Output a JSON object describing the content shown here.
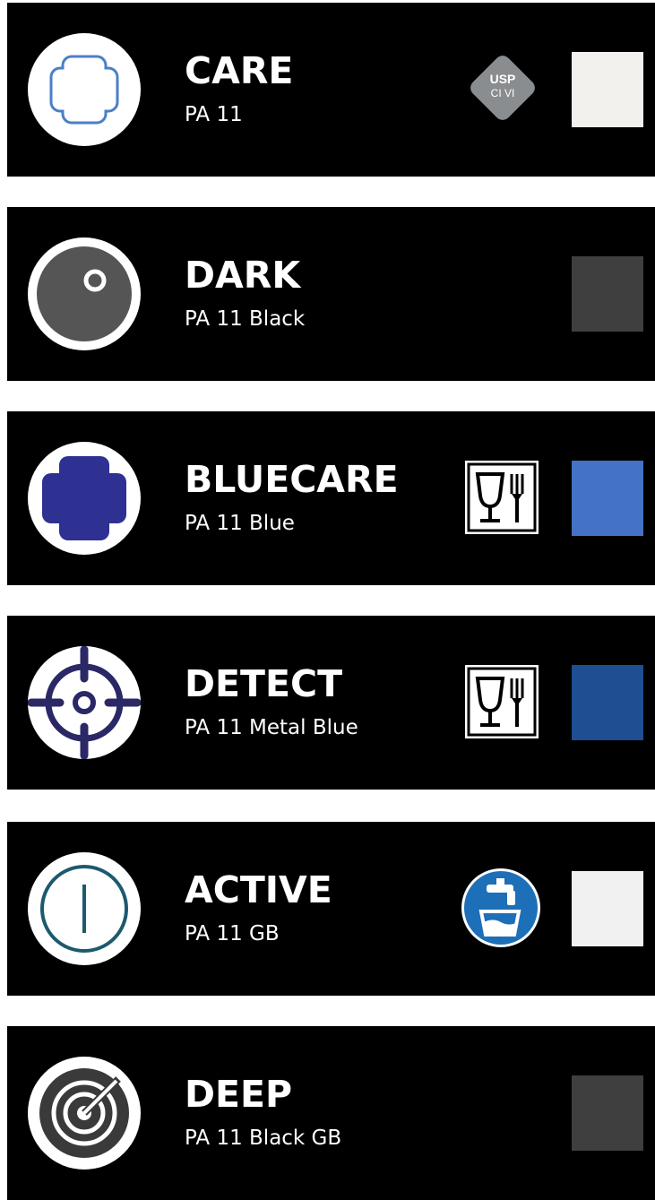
{
  "products": [
    {
      "name": "CARE",
      "grade": "PA 11",
      "icon": "cross-outline-icon",
      "badge": {
        "type": "usp-class-vi",
        "line1": "USP",
        "line2": "CI VI"
      },
      "swatch_color": "#f2f1ed"
    },
    {
      "name": "DARK",
      "grade": "PA 11 Black",
      "icon": "dark-ball-icon",
      "badge": null,
      "swatch_color": "#3f3f3f"
    },
    {
      "name": "BLUECARE",
      "grade": "PA 11 Blue",
      "icon": "blue-cross-icon",
      "badge": {
        "type": "food-contact"
      },
      "swatch_color": "#4472c4"
    },
    {
      "name": "DETECT",
      "grade": "PA 11 Metal Blue",
      "icon": "crosshair-icon",
      "badge": {
        "type": "food-contact"
      },
      "swatch_color": "#1f4e93"
    },
    {
      "name": "ACTIVE",
      "grade": "PA 11 GB",
      "icon": "power-line-icon",
      "badge": {
        "type": "drinking-water"
      },
      "swatch_color": "#f1f1f1"
    },
    {
      "name": "DEEP",
      "grade": "PA 11 Black GB",
      "icon": "radar-target-icon",
      "badge": null,
      "swatch_color": "#3f3f3f"
    }
  ]
}
